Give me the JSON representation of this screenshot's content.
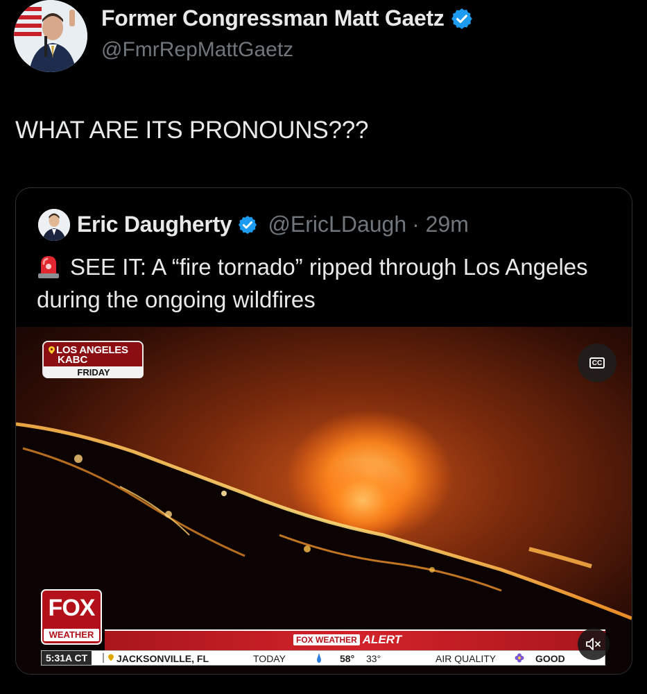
{
  "author": {
    "display_name": "Former Congressman Matt Gaetz",
    "handle": "@FmrRepMattGaetz",
    "verified": true,
    "avatar_icon": "user-photo-avatar"
  },
  "tweet": {
    "text": "WHAT ARE ITS PRONOUNS???"
  },
  "quoted_tweet": {
    "display_name": "Eric Daugherty",
    "handle": "@EricLDaugh",
    "time_meta": "· 29m",
    "verified": true,
    "leading_emoji": "siren-icon",
    "text": "SEE IT: A “fire tornado” ripped through Los Angeles during the ongoing wildfires"
  },
  "video": {
    "location_badge": {
      "line1": "LOS ANGELES",
      "line2": "KABC",
      "line3": "FRIDAY"
    },
    "cc_label": "CC",
    "logo": {
      "top": "FOX",
      "bottom": "WEATHER"
    },
    "alert": {
      "brand": "FOX WEATHER",
      "word": "ALERT"
    },
    "ticker": {
      "time": "5:31A CT",
      "location": "JACKSONVILLE, FL",
      "today": "TODAY",
      "high": "58°",
      "low": "33°",
      "air_quality_label": "AIR QUALITY",
      "air_quality_value": "GOOD"
    },
    "colors": {
      "fox_red": "#b3111a",
      "fire_orange": "#ff8a1f",
      "verified_blue": "#1d9bf0"
    }
  }
}
